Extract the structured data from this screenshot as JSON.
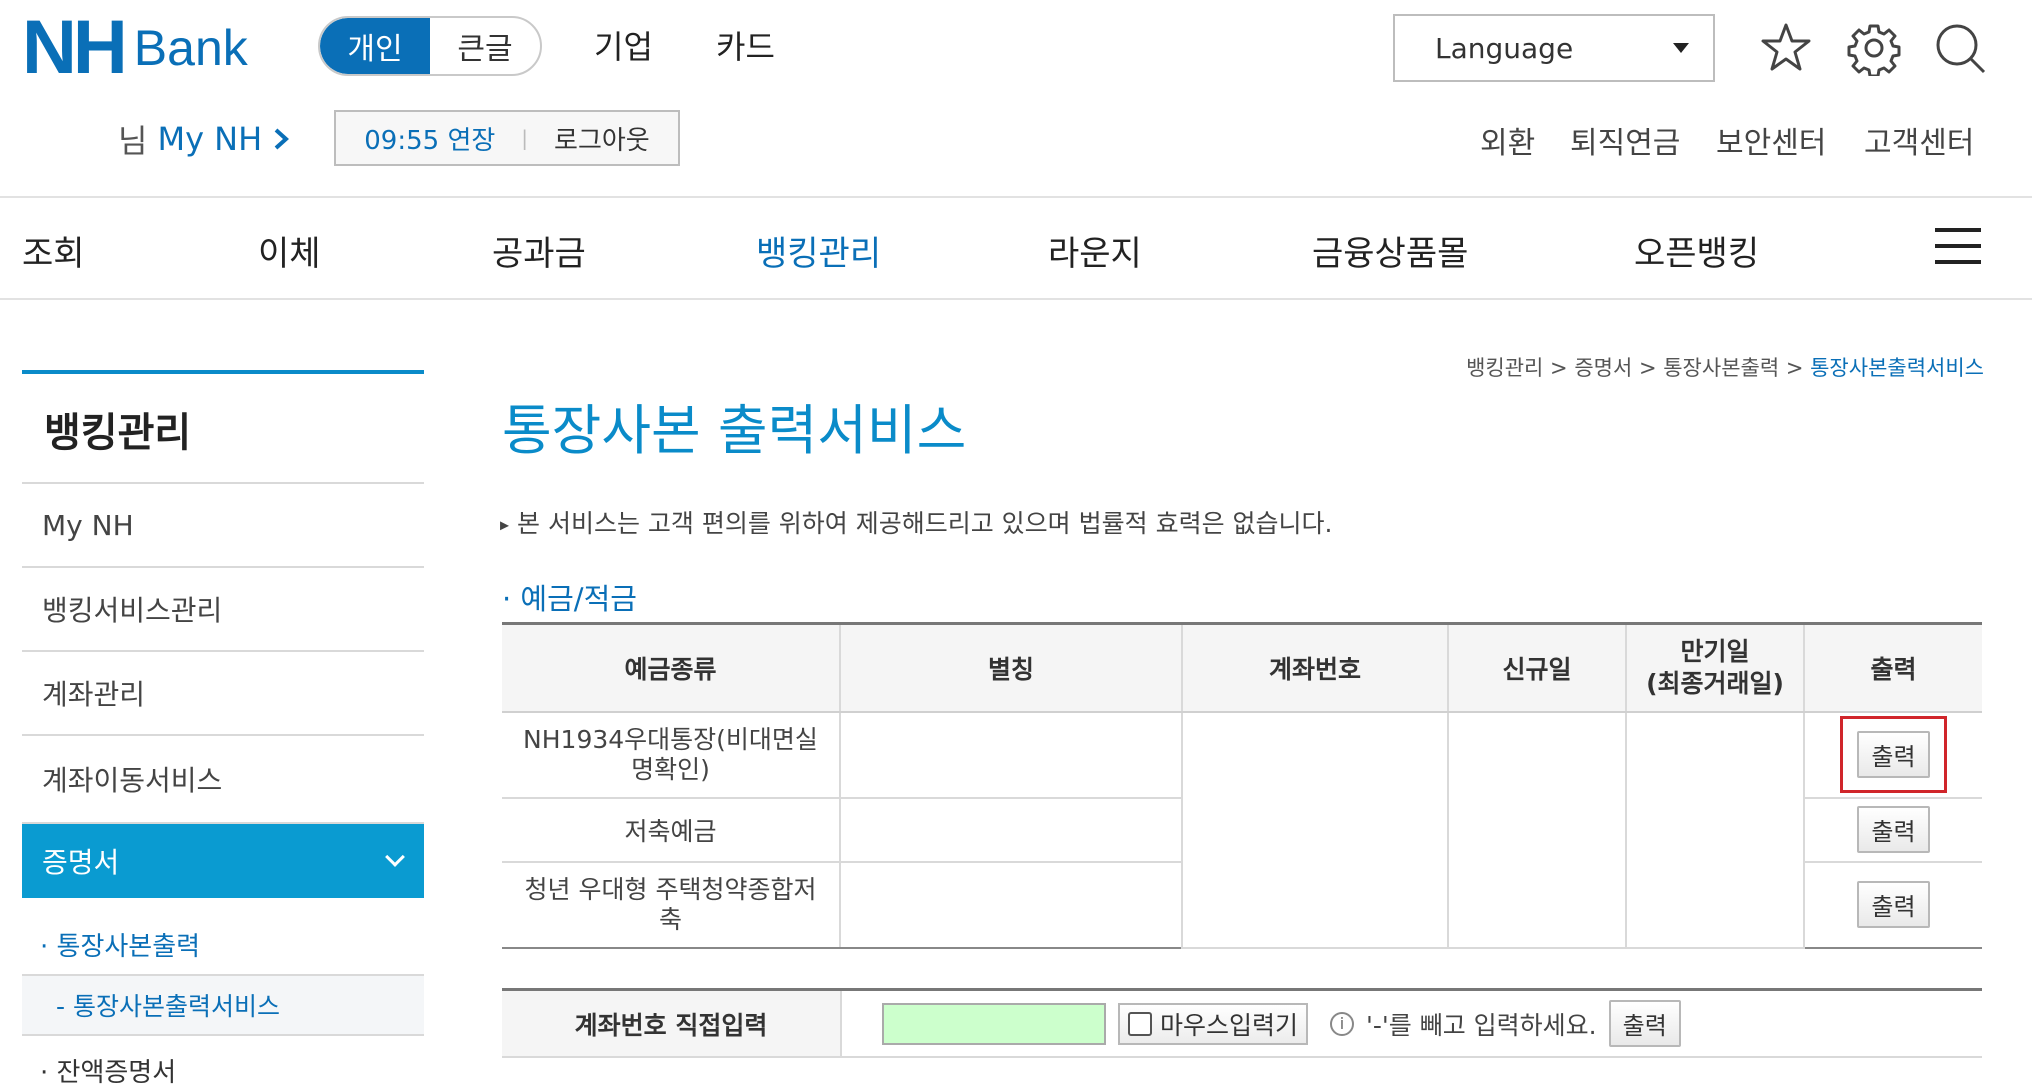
{
  "header": {
    "logo_nh": "NH",
    "logo_bank": "Bank",
    "mode_toggle": {
      "active": "개인",
      "inactive": "큰글"
    },
    "top_links": [
      "기업",
      "카드"
    ],
    "language_label": "Language",
    "icons": [
      "star-icon",
      "gear-icon",
      "search-icon"
    ],
    "user_suffix": "님",
    "my_nh_label": "My NH",
    "session_time": "09:55 연장",
    "logout_label": "로그아웃",
    "util_links": [
      "외환",
      "퇴직연금",
      "보안센터",
      "고객센터"
    ]
  },
  "gnb": {
    "items": [
      "조회",
      "이체",
      "공과금",
      "뱅킹관리",
      "라운지",
      "금융상품몰",
      "오픈뱅킹"
    ],
    "active": "뱅킹관리"
  },
  "sidebar": {
    "title": "뱅킹관리",
    "items": [
      "My NH",
      "뱅킹서비스관리",
      "계좌관리",
      "계좌이동서비스"
    ],
    "active_item": "증명서",
    "sub_items": [
      "· 통장사본출력",
      "- 통장사본출력서비스",
      "· 잔액증명서"
    ]
  },
  "breadcrumb": {
    "items": [
      "뱅킹관리",
      "증명서",
      "통장사본출력"
    ],
    "current": "통장사본출력서비스",
    "sep": " > "
  },
  "page": {
    "title": "통장사본 출력서비스",
    "notice": "본 서비스는 고객 편의를 위하여 제공해드리고 있으며 법률적 효력은 없습니다.",
    "section_title": "· 예금/적금"
  },
  "table": {
    "headers": [
      "예금종류",
      "별칭",
      "계좌번호",
      "신규일",
      "만기일\n(최종거래일)",
      "출력"
    ],
    "rows": [
      {
        "type": "NH1934우대통장(비대면실명확인)",
        "alias": "",
        "account": "",
        "open_date": "",
        "due_date": "",
        "button": "출력"
      },
      {
        "type": "저축예금",
        "alias": "",
        "account": "",
        "open_date": "",
        "due_date": "",
        "button": "출력"
      },
      {
        "type": "청년 우대형 주택청약종합저축",
        "alias": "",
        "account": "",
        "open_date": "",
        "due_date": "",
        "button": "출력"
      }
    ]
  },
  "direct_input": {
    "label": "계좌번호 직접입력",
    "value": "",
    "mouse_input_label": "마우스입력기",
    "hint": "'-'를 빼고 입력하세요.",
    "button": "출력"
  },
  "colors": {
    "brand": "#0a6fb7",
    "sidebar_active": "#0a9bd1",
    "highlight_border": "#d0252a",
    "input_bg": "#ccffcc"
  }
}
